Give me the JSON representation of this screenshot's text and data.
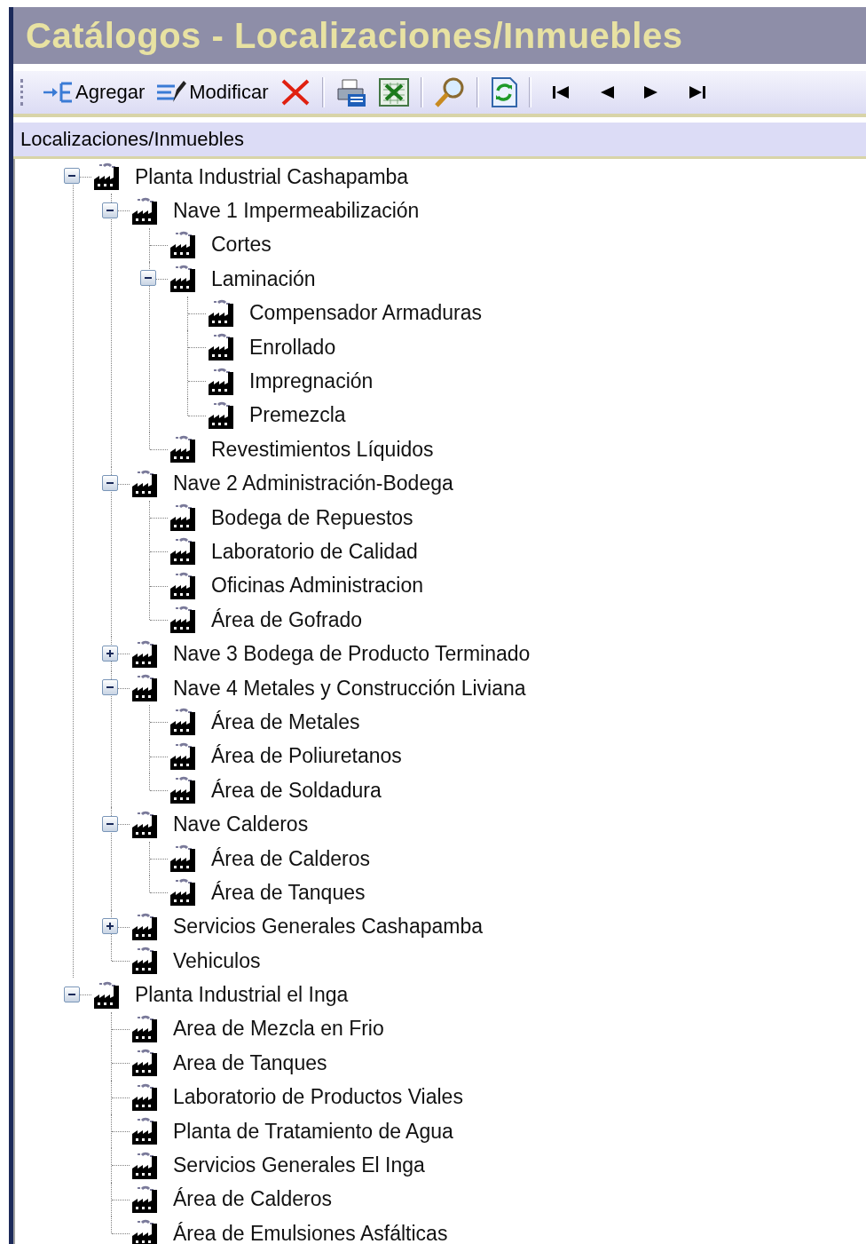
{
  "window": {
    "title": "Catálogos - Localizaciones/Inmuebles"
  },
  "toolbar": {
    "items": [
      {
        "kind": "add",
        "label": "Agregar"
      },
      {
        "kind": "edit",
        "label": "Modificar"
      },
      {
        "kind": "delete"
      },
      {
        "kind": "separator"
      },
      {
        "kind": "print"
      },
      {
        "kind": "excel"
      },
      {
        "kind": "separator"
      },
      {
        "kind": "search"
      },
      {
        "kind": "separator"
      },
      {
        "kind": "refresh"
      },
      {
        "kind": "separator"
      },
      {
        "kind": "first"
      },
      {
        "kind": "previous"
      },
      {
        "kind": "next"
      },
      {
        "kind": "last"
      }
    ]
  },
  "tree": {
    "header": "Localizaciones/Inmuebles",
    "nodes": [
      {
        "label": "Planta Industrial Cashapamba",
        "expanded": true,
        "children": [
          {
            "label": "Nave 1 Impermeabilización",
            "expanded": true,
            "children": [
              {
                "label": "Cortes"
              },
              {
                "label": "Laminación",
                "expanded": true,
                "children": [
                  {
                    "label": "Compensador Armaduras"
                  },
                  {
                    "label": "Enrollado"
                  },
                  {
                    "label": "Impregnación"
                  },
                  {
                    "label": "Premezcla"
                  }
                ]
              },
              {
                "label": "Revestimientos Líquidos"
              }
            ]
          },
          {
            "label": "Nave 2 Administración-Bodega",
            "expanded": true,
            "children": [
              {
                "label": "Bodega de Repuestos"
              },
              {
                "label": "Laboratorio de Calidad"
              },
              {
                "label": "Oficinas Administracion"
              },
              {
                "label": "Área de Gofrado"
              }
            ]
          },
          {
            "label": "Nave 3 Bodega de Producto Terminado",
            "expanded": false
          },
          {
            "label": "Nave 4 Metales y Construcción Liviana",
            "expanded": true,
            "children": [
              {
                "label": "Área de Metales"
              },
              {
                "label": "Área de Poliuretanos"
              },
              {
                "label": "Área de Soldadura"
              }
            ]
          },
          {
            "label": "Nave Calderos",
            "expanded": true,
            "children": [
              {
                "label": "Área de Calderos"
              },
              {
                "label": "Área de Tanques"
              }
            ]
          },
          {
            "label": "Servicios Generales Cashapamba",
            "expanded": false
          },
          {
            "label": "Vehiculos"
          }
        ]
      },
      {
        "label": "Planta Industrial el Inga",
        "expanded": true,
        "children": [
          {
            "label": "Area de Mezcla en Frio"
          },
          {
            "label": "Area de Tanques"
          },
          {
            "label": "Laboratorio de Productos Viales"
          },
          {
            "label": "Planta de Tratamiento de Agua"
          },
          {
            "label": "Servicios Generales El Inga"
          },
          {
            "label": "Área de Calderos"
          },
          {
            "label": "Área de Emulsiones Asfálticas"
          }
        ]
      }
    ]
  }
}
